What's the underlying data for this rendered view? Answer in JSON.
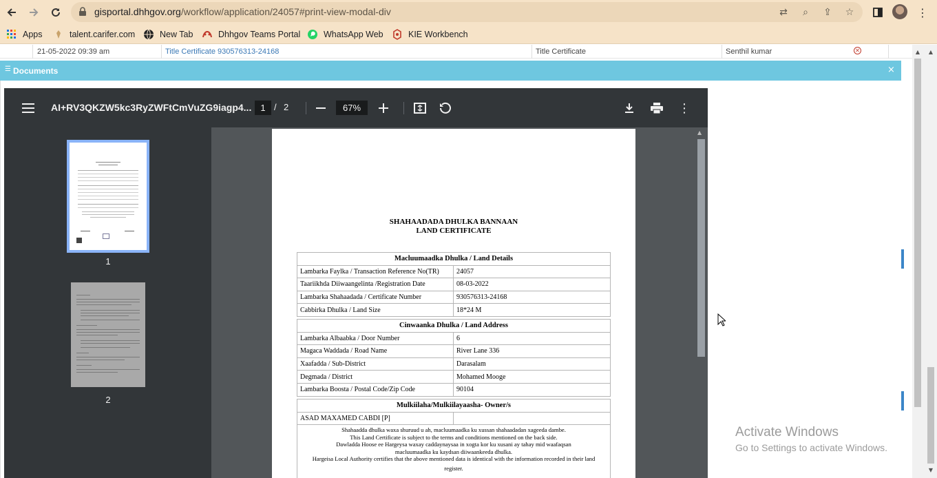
{
  "browser": {
    "url_domain": "gisportal.dhhgov.org",
    "url_path": "/workflow/application/24057#print-view-modal-div",
    "bookmarks": [
      {
        "label": "Apps",
        "icon": "apps-grid-icon"
      },
      {
        "label": "talent.carifer.com",
        "icon": "carifer-icon"
      },
      {
        "label": "New Tab",
        "icon": "globe-icon"
      },
      {
        "label": "Dhhgov Teams Portal",
        "icon": "teams-portal-icon"
      },
      {
        "label": "WhatsApp Web",
        "icon": "whatsapp-icon"
      },
      {
        "label": "KIE Workbench",
        "icon": "kie-icon"
      }
    ]
  },
  "background_row": {
    "date": "21-05-2022 09:39 am",
    "document": "Title Certificate 930576313-24168",
    "type": "Title Certificate",
    "user": "Senthil kumar"
  },
  "modal": {
    "title": "Documents",
    "close_label": "×"
  },
  "pdf_viewer": {
    "filename": "AI+RV3QKZW5kc3RyZWFtCmVuZG9iagp4...",
    "current_page": "1",
    "page_separator": "/",
    "total_pages": "2",
    "zoom": "67%",
    "thumbnails": [
      {
        "label": "1"
      },
      {
        "label": "2"
      }
    ]
  },
  "certificate": {
    "title_line1": "SHAHAADADA DHULKA BANNAAN",
    "title_line2": "LAND CERTIFICATE",
    "land_details": {
      "heading": "Macluumaadka Dhulka / Land Details",
      "rows": [
        {
          "label": "Lambarka Faylka / Transaction Reference No(TR)",
          "value": "24057"
        },
        {
          "label": "Taariikhda Diiwaangelinta /Registration Date",
          "value": "08-03-2022"
        },
        {
          "label": "Lambarka Shahaadada / Certificate Number",
          "value": "930576313-24168"
        },
        {
          "label": "Cabbirka Dhulka / Land Size",
          "value": "18*24 M"
        }
      ]
    },
    "land_address": {
      "heading": "Cinwaanka Dhulka / Land Address",
      "rows": [
        {
          "label": "Lambarka Albaabka / Door Number",
          "value": "6"
        },
        {
          "label": "Magaca Waddada / Road Name",
          "value": "River Lane 336"
        },
        {
          "label": "Xaafadda / Sub-District",
          "value": "Darasalam"
        },
        {
          "label": "Degmada / District",
          "value": "Mohamed Mooge"
        },
        {
          "label": "Lambarka Boosta / Postal Code/Zip Code",
          "value": "90104"
        }
      ]
    },
    "owners": {
      "heading": "Mulkiilaha/Mulkiilayaasha- Owner/s",
      "name": "ASAD MAXAMED CABDI [P]"
    },
    "notes": [
      "Shahaadda dhulka waxa shuruud u ah, macluumaadka ku xussan shahaadadan xageeda dambe.",
      "This Land Certificate is subject to the terms and conditions mentioned on the back side.",
      "Dawladda Hoose ee Hargeysa waxay caddaynaysaa in xogta kor ku xusani ay tahay mid waafaqsan",
      "macluumaadka ku kaydsan diiwaankeeda dhulka.",
      "Hargeisa Local Authority certifies that the above mentioned data is identical with the information recorded in their land",
      "register."
    ]
  },
  "watermark": {
    "line1": "Activate Windows",
    "line2": "Go to Settings to activate Windows."
  },
  "colors": {
    "chrome_bg": "#f6e3c8",
    "modal_header": "#6ec7e0",
    "pdf_toolbar": "#323639",
    "pdf_bg": "#525659",
    "thumb_highlight": "#8ab4f8"
  }
}
